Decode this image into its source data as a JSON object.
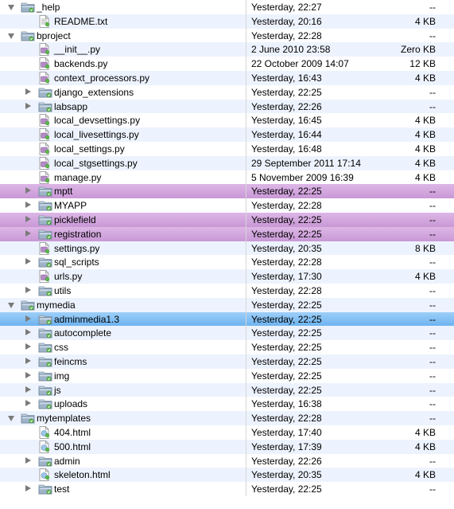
{
  "colors": {
    "alt_row": "#edf3fe",
    "label_purple": "#d4a8df",
    "selection_blue": "#7fbdf3",
    "folder": "#9fb3c8",
    "script_icon": "#b48ac6"
  },
  "rows": [
    {
      "name": "_help",
      "date": "Yesterday, 22:27",
      "size": "--",
      "type": "folder",
      "level": 0,
      "disclosure": "open",
      "state": ""
    },
    {
      "name": "README.txt",
      "date": "Yesterday, 20:16",
      "size": "4 KB",
      "type": "text",
      "level": 1,
      "disclosure": "",
      "state": ""
    },
    {
      "name": "bproject",
      "date": "Yesterday, 22:28",
      "size": "--",
      "type": "folder",
      "level": 0,
      "disclosure": "open",
      "state": ""
    },
    {
      "name": "__init__.py",
      "date": "2 June 2010 23:58",
      "size": "Zero KB",
      "type": "script",
      "level": 1,
      "disclosure": "",
      "state": ""
    },
    {
      "name": "backends.py",
      "date": "22 October 2009 14:07",
      "size": "12 KB",
      "type": "script",
      "level": 1,
      "disclosure": "",
      "state": ""
    },
    {
      "name": "context_processors.py",
      "date": "Yesterday, 16:43",
      "size": "4 KB",
      "type": "script",
      "level": 1,
      "disclosure": "",
      "state": ""
    },
    {
      "name": "django_extensions",
      "date": "Yesterday, 22:25",
      "size": "--",
      "type": "folder",
      "level": 1,
      "disclosure": "closed",
      "state": ""
    },
    {
      "name": "labsapp",
      "date": "Yesterday, 22:26",
      "size": "--",
      "type": "folder",
      "level": 1,
      "disclosure": "closed",
      "state": ""
    },
    {
      "name": "local_devsettings.py",
      "date": "Yesterday, 16:45",
      "size": "4 KB",
      "type": "script",
      "level": 1,
      "disclosure": "",
      "state": ""
    },
    {
      "name": "local_livesettings.py",
      "date": "Yesterday, 16:44",
      "size": "4 KB",
      "type": "script",
      "level": 1,
      "disclosure": "",
      "state": ""
    },
    {
      "name": "local_settings.py",
      "date": "Yesterday, 16:48",
      "size": "4 KB",
      "type": "script",
      "level": 1,
      "disclosure": "",
      "state": ""
    },
    {
      "name": "local_stgsettings.py",
      "date": "29 September 2011 17:14",
      "size": "4 KB",
      "type": "script",
      "level": 1,
      "disclosure": "",
      "state": ""
    },
    {
      "name": "manage.py",
      "date": "5 November 2009 16:39",
      "size": "4 KB",
      "type": "script",
      "level": 1,
      "disclosure": "",
      "state": ""
    },
    {
      "name": "mptt",
      "date": "Yesterday, 22:25",
      "size": "--",
      "type": "folder",
      "level": 1,
      "disclosure": "closed",
      "state": "labeled"
    },
    {
      "name": "MYAPP",
      "date": "Yesterday, 22:28",
      "size": "--",
      "type": "folder",
      "level": 1,
      "disclosure": "closed",
      "state": ""
    },
    {
      "name": "picklefield",
      "date": "Yesterday, 22:25",
      "size": "--",
      "type": "folder",
      "level": 1,
      "disclosure": "closed",
      "state": "labeled"
    },
    {
      "name": "registration",
      "date": "Yesterday, 22:25",
      "size": "--",
      "type": "folder",
      "level": 1,
      "disclosure": "closed",
      "state": "labeled"
    },
    {
      "name": "settings.py",
      "date": "Yesterday, 20:35",
      "size": "8 KB",
      "type": "script",
      "level": 1,
      "disclosure": "",
      "state": ""
    },
    {
      "name": "sql_scripts",
      "date": "Yesterday, 22:28",
      "size": "--",
      "type": "folder",
      "level": 1,
      "disclosure": "closed",
      "state": ""
    },
    {
      "name": "urls.py",
      "date": "Yesterday, 17:30",
      "size": "4 KB",
      "type": "script",
      "level": 1,
      "disclosure": "",
      "state": ""
    },
    {
      "name": "utils",
      "date": "Yesterday, 22:28",
      "size": "--",
      "type": "folder",
      "level": 1,
      "disclosure": "closed",
      "state": ""
    },
    {
      "name": "mymedia",
      "date": "Yesterday, 22:25",
      "size": "--",
      "type": "folder",
      "level": 0,
      "disclosure": "open",
      "state": ""
    },
    {
      "name": "adminmedia1.3",
      "date": "Yesterday, 22:25",
      "size": "--",
      "type": "folder",
      "level": 1,
      "disclosure": "closed",
      "state": "selected"
    },
    {
      "name": "autocomplete",
      "date": "Yesterday, 22:25",
      "size": "--",
      "type": "folder",
      "level": 1,
      "disclosure": "closed",
      "state": ""
    },
    {
      "name": "css",
      "date": "Yesterday, 22:25",
      "size": "--",
      "type": "folder",
      "level": 1,
      "disclosure": "closed",
      "state": ""
    },
    {
      "name": "feincms",
      "date": "Yesterday, 22:25",
      "size": "--",
      "type": "folder",
      "level": 1,
      "disclosure": "closed",
      "state": ""
    },
    {
      "name": "img",
      "date": "Yesterday, 22:25",
      "size": "--",
      "type": "folder",
      "level": 1,
      "disclosure": "closed",
      "state": ""
    },
    {
      "name": "js",
      "date": "Yesterday, 22:25",
      "size": "--",
      "type": "folder",
      "level": 1,
      "disclosure": "closed",
      "state": ""
    },
    {
      "name": "uploads",
      "date": "Yesterday, 16:38",
      "size": "--",
      "type": "folder",
      "level": 1,
      "disclosure": "closed",
      "state": ""
    },
    {
      "name": "mytemplates",
      "date": "Yesterday, 22:28",
      "size": "--",
      "type": "folder",
      "level": 0,
      "disclosure": "open",
      "state": ""
    },
    {
      "name": "404.html",
      "date": "Yesterday, 17:40",
      "size": "4 KB",
      "type": "html",
      "level": 1,
      "disclosure": "",
      "state": ""
    },
    {
      "name": "500.html",
      "date": "Yesterday, 17:39",
      "size": "4 KB",
      "type": "html",
      "level": 1,
      "disclosure": "",
      "state": ""
    },
    {
      "name": "admin",
      "date": "Yesterday, 22:26",
      "size": "--",
      "type": "folder",
      "level": 1,
      "disclosure": "closed",
      "state": ""
    },
    {
      "name": "skeleton.html",
      "date": "Yesterday, 20:35",
      "size": "4 KB",
      "type": "html",
      "level": 1,
      "disclosure": "",
      "state": ""
    },
    {
      "name": "test",
      "date": "Yesterday, 22:25",
      "size": "--",
      "type": "folder",
      "level": 1,
      "disclosure": "closed",
      "state": ""
    }
  ]
}
